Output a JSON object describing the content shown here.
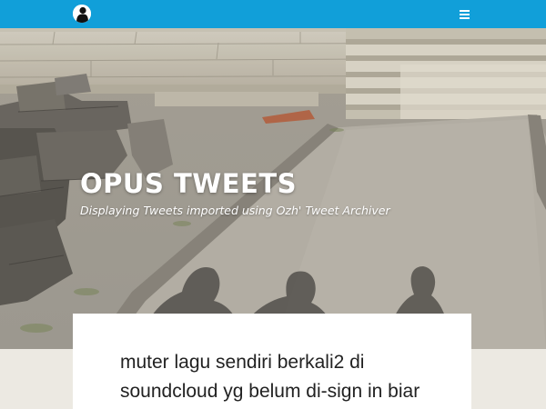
{
  "header": {
    "avatar_icon": "user-avatar-icon",
    "menu_icon": "hamburger-menu-icon",
    "bar_color": "#119fd9"
  },
  "hero": {
    "site_title": "OPUS TWEETS",
    "tagline": "Displaying Tweets imported using Ozh' Tweet Archiver"
  },
  "tweet": {
    "text": "muter lagu sendiri berkali2 di soundcloud yg belum di-sign in biar"
  }
}
